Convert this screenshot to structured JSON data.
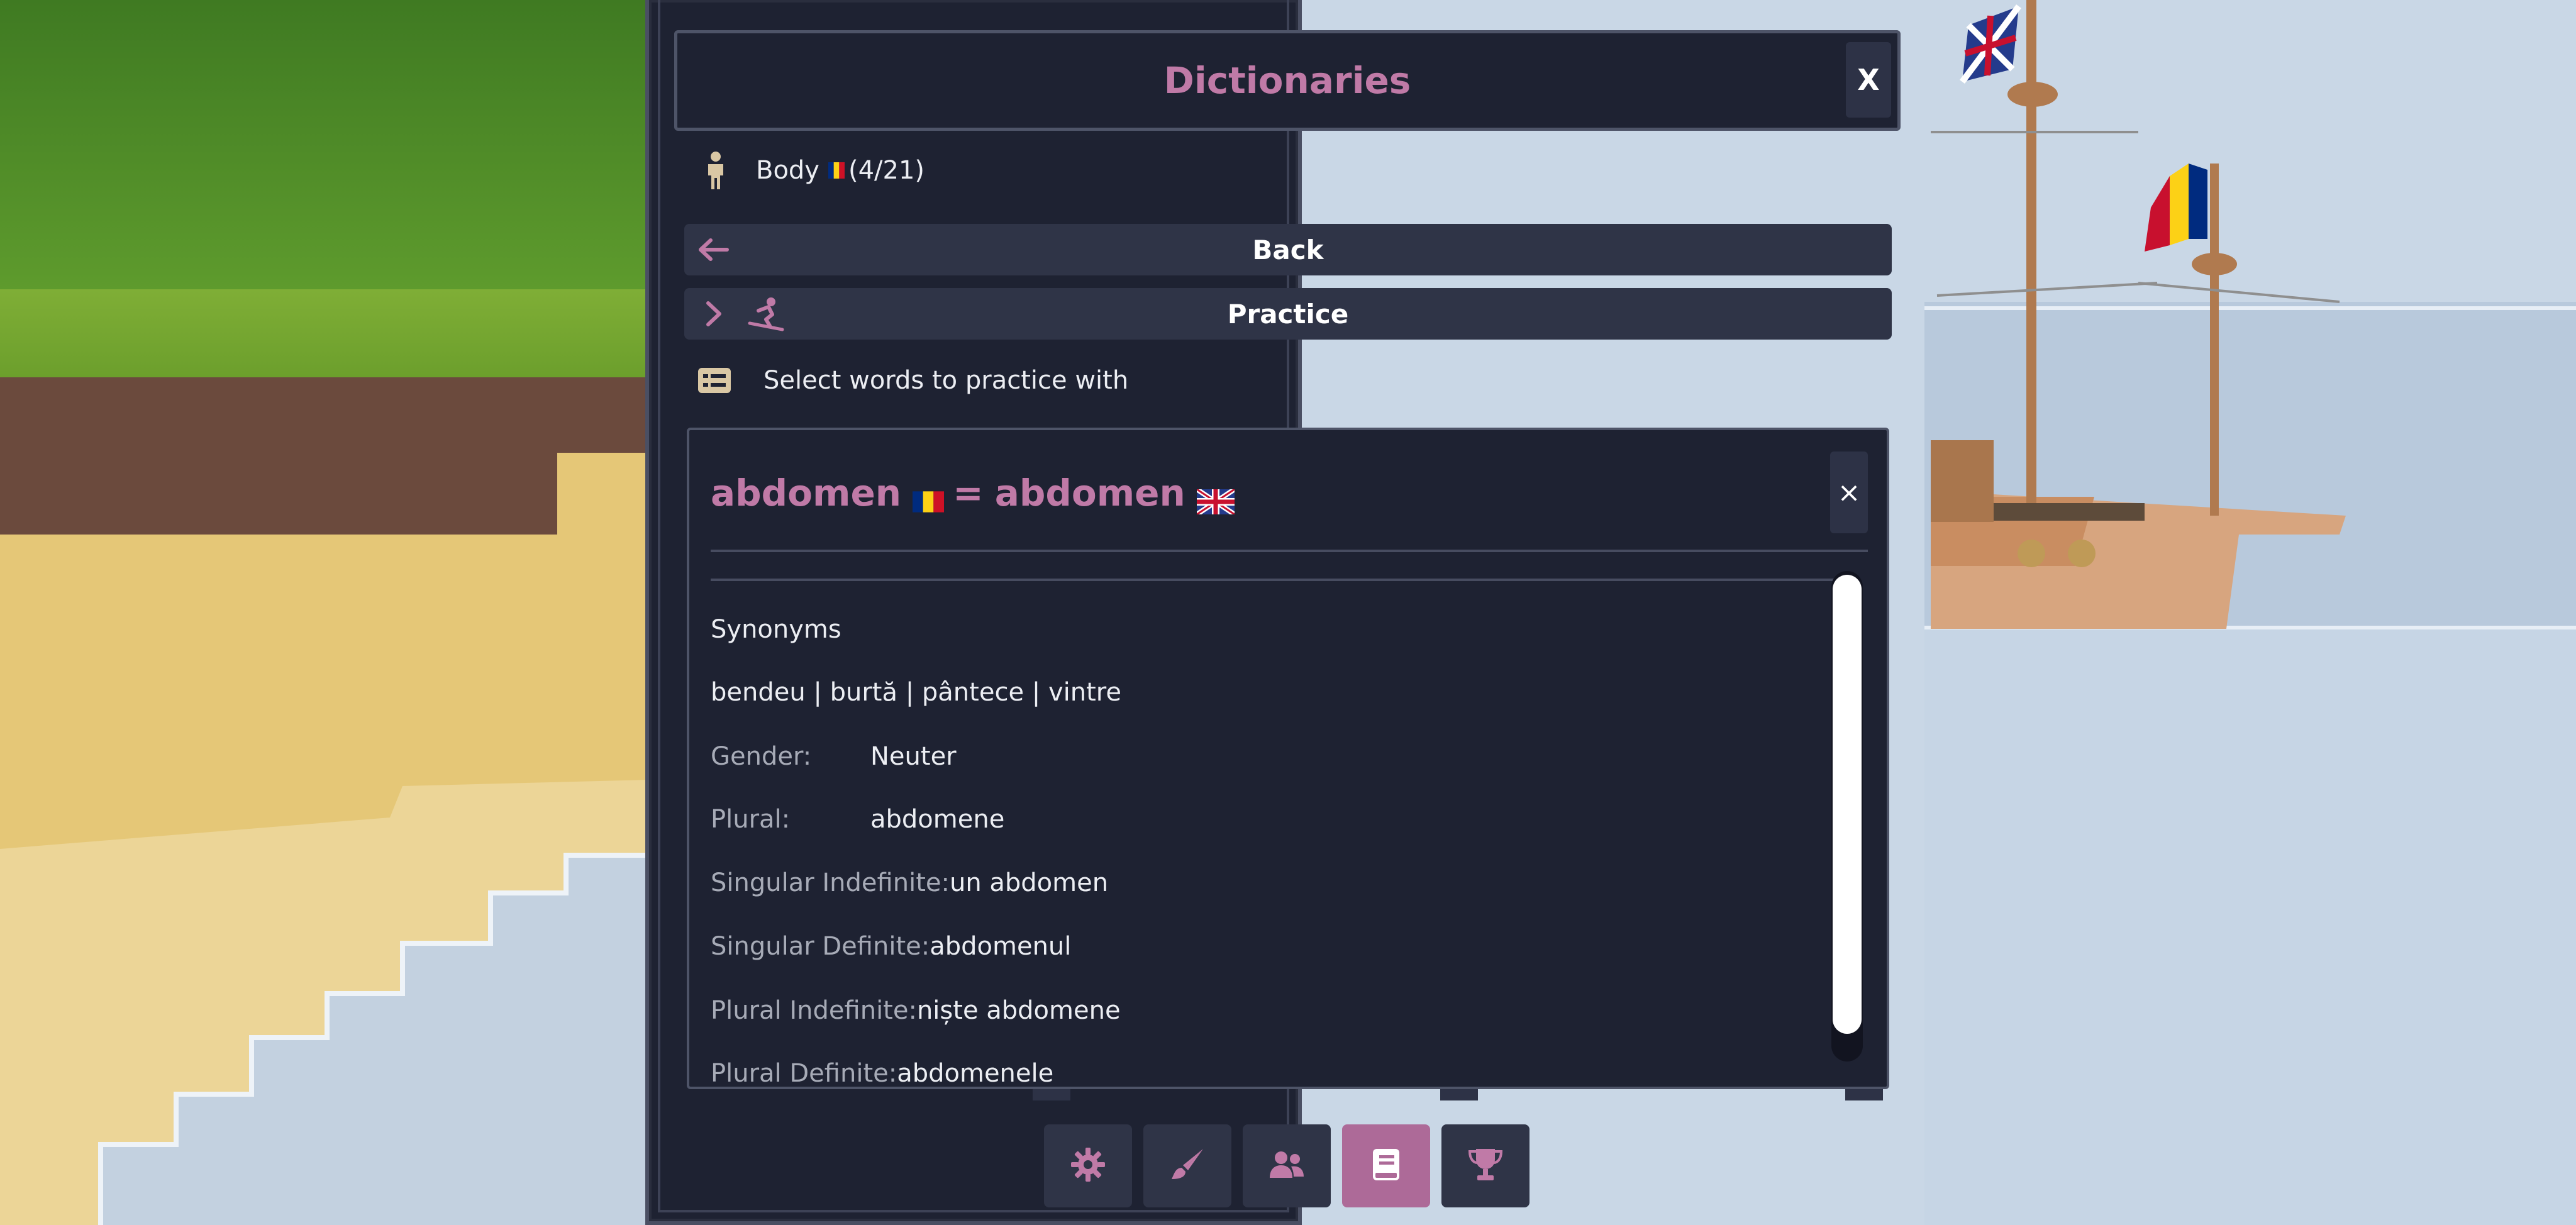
{
  "window": {
    "title": "Dictionaries",
    "close_label": "X"
  },
  "breadcrumb": {
    "label": "Body",
    "count": "(4/21)",
    "icon": "person-icon"
  },
  "buttons": {
    "back_label": "Back",
    "practice_label": "Practice"
  },
  "hint": {
    "text": "Select words to practice with"
  },
  "word": {
    "source_word": "abdomen",
    "equals": "=",
    "target_word": "abdomen",
    "close_label": "×",
    "synonyms_heading": "Synonyms",
    "synonyms": "bendeu | burtă | pântece | vintre",
    "properties": [
      {
        "key": "Gender:",
        "value": "Neuter"
      },
      {
        "key": "Plural:",
        "value": "abdomene"
      },
      {
        "key": "Singular Indefinite:",
        "value": "un abdomen"
      },
      {
        "key": "Singular Definite:",
        "value": "abdomenul"
      },
      {
        "key": "Plural Indefinite:",
        "value": "niște abdomene"
      },
      {
        "key": "Plural Definite:",
        "value": "abdomenele"
      }
    ]
  },
  "toolbar": {
    "items": [
      {
        "name": "settings",
        "icon": "gear-icon"
      },
      {
        "name": "customize",
        "icon": "paintbrush-icon"
      },
      {
        "name": "friends",
        "icon": "users-icon"
      },
      {
        "name": "dictionaries",
        "icon": "book-icon",
        "active": true
      },
      {
        "name": "achievements",
        "icon": "trophy-icon"
      }
    ]
  },
  "colors": {
    "accent": "#c07aa7",
    "panel_bg": "#1e2232",
    "button_bg": "#2f3447",
    "active_tab": "#ad6a98"
  }
}
